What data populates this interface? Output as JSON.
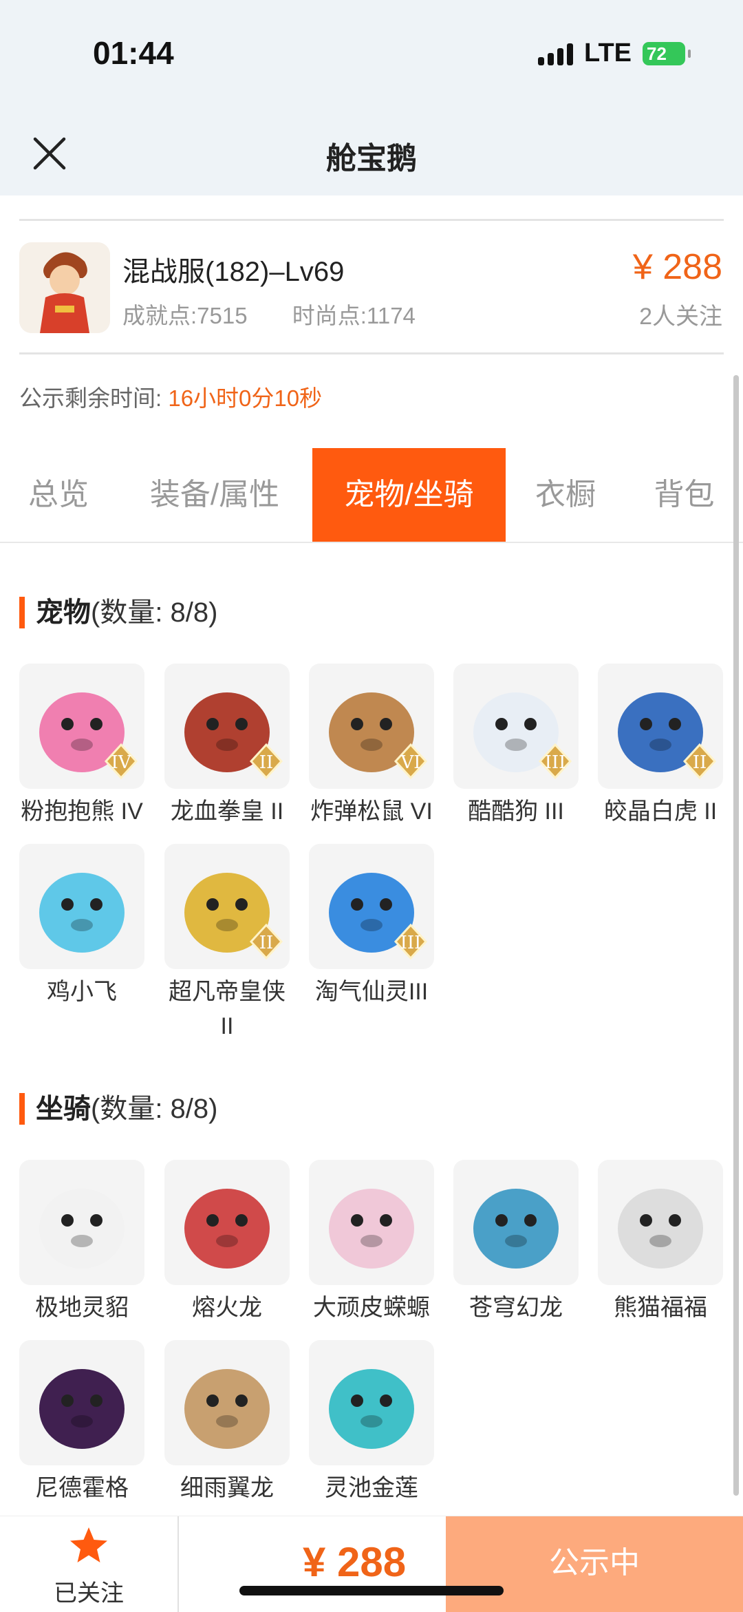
{
  "status": {
    "time": "01:44",
    "network": "LTE",
    "battery": "72"
  },
  "nav": {
    "title": "舱宝鹅"
  },
  "character": {
    "title": "混战服(182)–Lv69",
    "achievement": "成就点:7515",
    "fashion": "时尚点:1174",
    "price": "¥ 288",
    "followers": "2人关注"
  },
  "notice": {
    "label": "公示剩余时间:",
    "countdown": "16小时0分10秒"
  },
  "tabs": [
    {
      "label": "总览"
    },
    {
      "label": "装备/属性"
    },
    {
      "label": "宠物/坐骑"
    },
    {
      "label": "衣橱"
    },
    {
      "label": "背包"
    }
  ],
  "pets": {
    "title": "宠物",
    "count": "(数量: 8/8)",
    "items": [
      {
        "name": "粉抱抱熊 IV",
        "color": "#f07fb0",
        "badge": "IV"
      },
      {
        "name": "龙血拳皇 II",
        "color": "#b04030",
        "badge": "II"
      },
      {
        "name": "炸弹松鼠 VI",
        "color": "#c08850",
        "badge": "VI"
      },
      {
        "name": "酷酷狗 III",
        "color": "#e8eef5",
        "badge": "III"
      },
      {
        "name": "皎晶白虎 II",
        "color": "#3a70c0",
        "badge": "II"
      },
      {
        "name": "鸡小飞",
        "color": "#5fc8e8",
        "badge": ""
      },
      {
        "name": "超凡帝皇侠 II",
        "color": "#e0b840",
        "badge": "II"
      },
      {
        "name": "淘气仙灵III",
        "color": "#3a8de0",
        "badge": "III"
      }
    ]
  },
  "mounts": {
    "title": "坐骑",
    "count": "(数量: 8/8)",
    "items": [
      {
        "name": "极地灵貂",
        "color": "#f2f2f2"
      },
      {
        "name": "熔火龙",
        "color": "#d04a4a"
      },
      {
        "name": "大顽皮蝾螈",
        "color": "#f0c8d8"
      },
      {
        "name": "苍穹幻龙",
        "color": "#4aa0c8"
      },
      {
        "name": "熊猫福福",
        "color": "#dddddd"
      },
      {
        "name": "尼德霍格",
        "color": "#402050"
      },
      {
        "name": "细雨翼龙",
        "color": "#c8a070"
      },
      {
        "name": "灵池金莲",
        "color": "#40c0c8"
      }
    ]
  },
  "bottom": {
    "follow_label": "已关注",
    "price": "¥ 288",
    "action": "公示中"
  }
}
